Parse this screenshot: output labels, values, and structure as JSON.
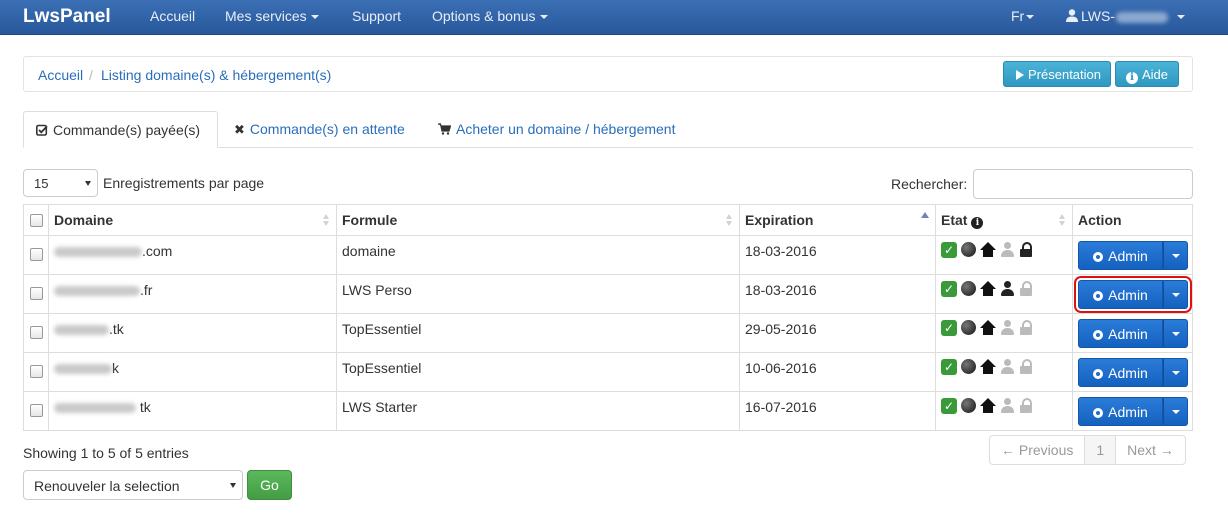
{
  "navbar": {
    "brand": "LwsPanel",
    "items": [
      {
        "label": "Accueil"
      },
      {
        "label": "Mes services"
      },
      {
        "label": "Support"
      },
      {
        "label": "Options & bonus"
      }
    ],
    "language": "Fr",
    "user_prefix": "LWS-"
  },
  "breadcrumb": {
    "home": "Accueil",
    "separator": "/",
    "current": "Listing domaine(s) & hébergement(s)"
  },
  "header_buttons": {
    "presentation": "Présentation",
    "help": "Aide"
  },
  "tabs": [
    {
      "label": "Commande(s) payée(s)",
      "icon": "check-square-icon",
      "active": true
    },
    {
      "label": "Commande(s) en attente",
      "icon": "close-icon",
      "active": false
    },
    {
      "label": "Acheter un domaine / hébergement",
      "icon": "cart-icon",
      "active": false
    }
  ],
  "table_controls": {
    "page_length": "15",
    "page_length_label": "Enregistrements par page",
    "search_label": "Rechercher:",
    "search_value": ""
  },
  "table": {
    "columns": [
      "Domaine",
      "Formule",
      "Expiration",
      "Etat",
      "Action"
    ],
    "rows": [
      {
        "domain_suffix": ".com",
        "formula": "domaine",
        "expiration": "18-03-2016",
        "user_active": false,
        "lock_active": true,
        "action": "Admin",
        "highlighted": false
      },
      {
        "domain_suffix": ".fr",
        "formula": "LWS Perso",
        "expiration": "18-03-2016",
        "user_active": true,
        "lock_active": false,
        "action": "Admin",
        "highlighted": true
      },
      {
        "domain_suffix": ".tk",
        "formula": "TopEssentiel",
        "expiration": "29-05-2016",
        "user_active": false,
        "lock_active": false,
        "action": "Admin",
        "highlighted": false
      },
      {
        "domain_suffix": "k",
        "formula": "TopEssentiel",
        "expiration": "10-06-2016",
        "user_active": false,
        "lock_active": false,
        "action": "Admin",
        "highlighted": false
      },
      {
        "domain_suffix": " tk",
        "formula": "LWS Starter",
        "expiration": "16-07-2016",
        "user_active": false,
        "lock_active": false,
        "action": "Admin",
        "highlighted": false
      }
    ]
  },
  "footer": {
    "showing": "Showing 1 to 5 of 5 entries",
    "pagination": {
      "previous": "← Previous",
      "current_page": "1",
      "next": "Next →"
    },
    "bulk_action": "Renouveler la selection",
    "go": "Go"
  },
  "colors": {
    "navbar": "#28589c",
    "link": "#2a6ebb",
    "primary_button": "#1462bf",
    "info_button": "#2f98c1",
    "success_button": "#449d44",
    "highlight_outline": "#e01010",
    "status_ok": "#3a9a3a"
  }
}
